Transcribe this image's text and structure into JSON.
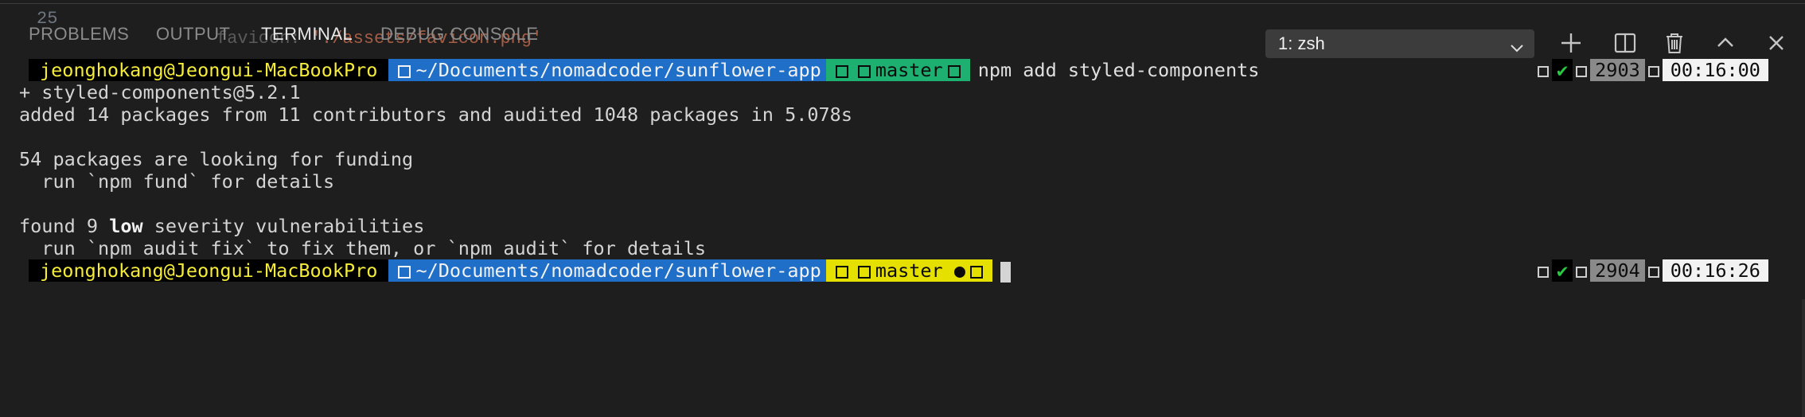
{
  "editor": {
    "line_number": "25",
    "code_key": "favicon",
    "code_value": "./assets/favicon.png"
  },
  "tabs": [
    "PROBLEMS",
    "OUTPUT",
    "TERMINAL",
    "DEBUG CONSOLE"
  ],
  "active_tab": "TERMINAL",
  "terminal_selector": {
    "value": "1: zsh"
  },
  "toolbar_icons": [
    "plus-icon",
    "split-icon",
    "trash-icon",
    "chevron-up-icon",
    "close-icon"
  ],
  "prompt1": {
    "user": "jeonghokang@Jeongui-MacBookPro",
    "path": "~/Documents/nomadcoder/sunflower-app",
    "branch": "master",
    "command": "npm add styled-components",
    "history": "2903",
    "time": "00:16:00"
  },
  "output": {
    "l1": "+ styled-components@5.2.1",
    "l2": "added 14 packages from 11 contributors and audited 1048 packages in 5.078s",
    "l3": "54 packages are looking for funding",
    "l4": "  run `npm fund` for details",
    "l5_prefix": "found 9 ",
    "l5_bold": "low",
    "l5_suffix": " severity vulnerabilities",
    "l6": "  run `npm audit fix` to fix them, or `npm audit` for details"
  },
  "prompt2": {
    "user": "jeonghokang@Jeongui-MacBookPro",
    "path": "~/Documents/nomadcoder/sunflower-app",
    "branch": "master",
    "dirty_mark": "●",
    "history": "2904",
    "time": "00:16:26"
  },
  "colors": {
    "background": "#1e1e1e",
    "path_segment": "#1f6fc8",
    "git_clean": "#1eb071",
    "git_dirty": "#e6e000",
    "user_text": "#f5ec3a"
  }
}
